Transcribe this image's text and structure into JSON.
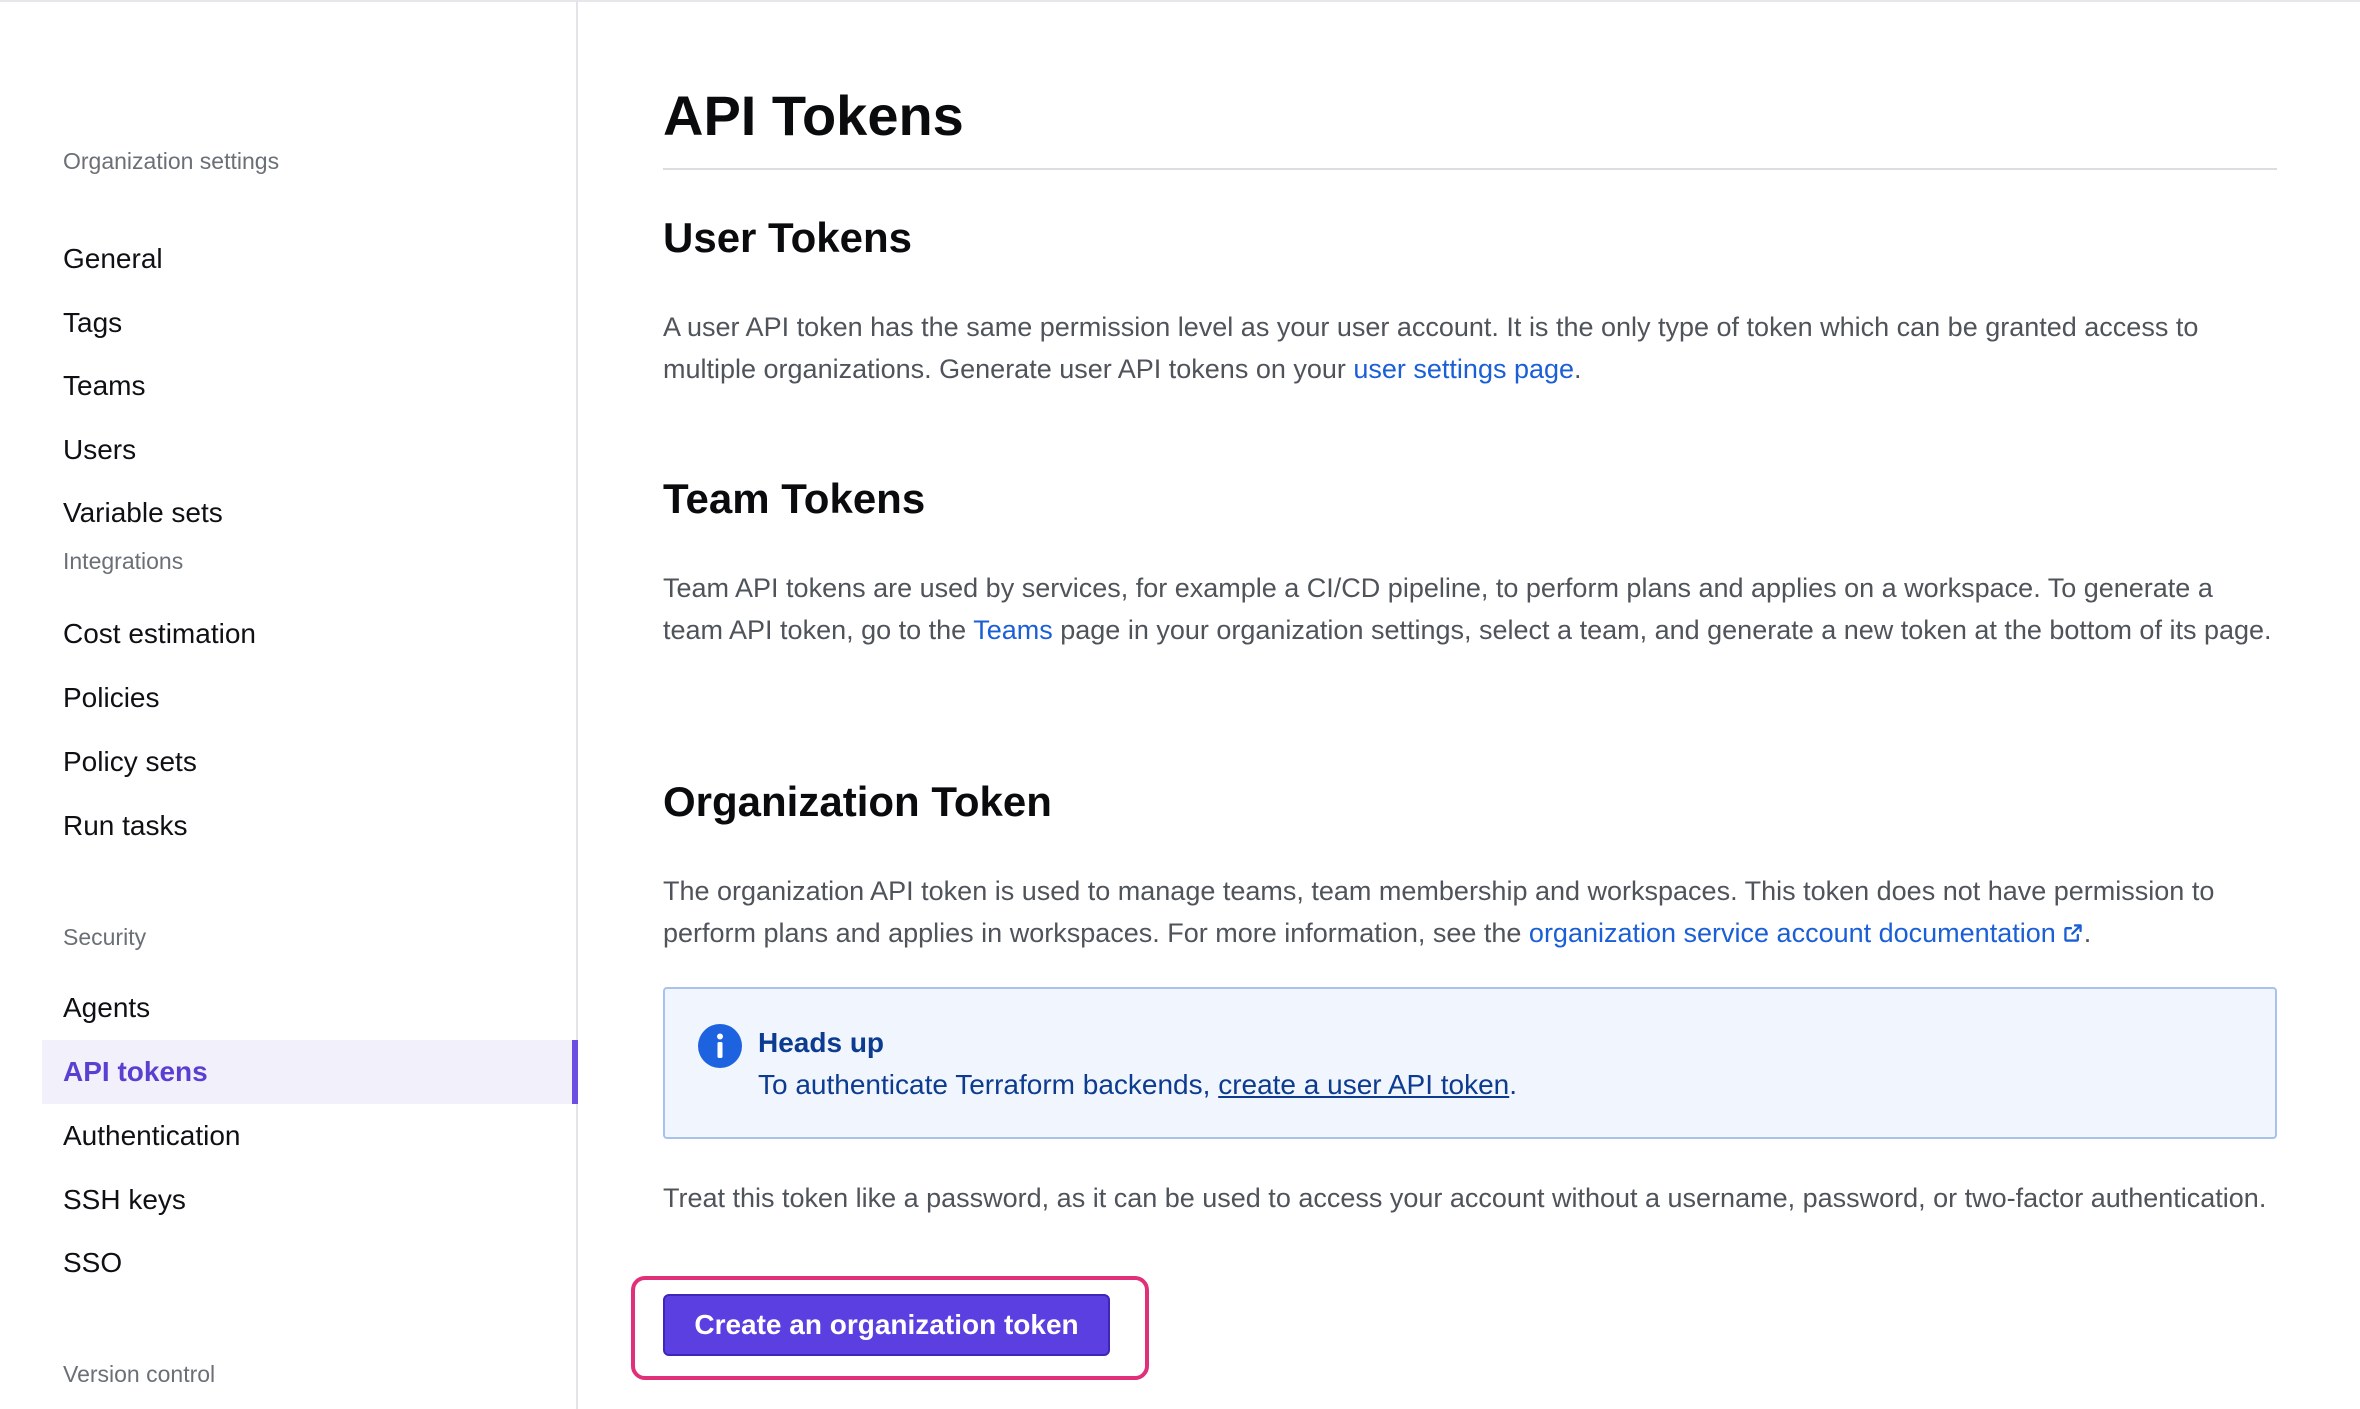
{
  "sidebar": {
    "sections": [
      {
        "heading": "Organization settings",
        "items": [
          "General",
          "Tags",
          "Teams",
          "Users",
          "Variable sets"
        ]
      },
      {
        "heading": "Integrations",
        "items": [
          "Cost estimation",
          "Policies",
          "Policy sets",
          "Run tasks"
        ]
      },
      {
        "heading": "Security",
        "items": [
          "Agents",
          "API tokens",
          "Authentication",
          "SSH keys",
          "SSO"
        ]
      },
      {
        "heading": "Version control",
        "items": []
      }
    ],
    "active_item": "API tokens"
  },
  "main": {
    "title": "API Tokens",
    "user_tokens": {
      "heading": "User Tokens",
      "text_before_link": "A user API token has the same permission level as your user account. It is the only type of token which can be granted access to multiple organizations. Generate user API tokens on your ",
      "link": "user settings page",
      "text_after_link": "."
    },
    "team_tokens": {
      "heading": "Team Tokens",
      "text_before_link": "Team API tokens are used by services, for example a CI/CD pipeline, to perform plans and applies on a workspace. To generate a team API token, go to the ",
      "link": "Teams",
      "text_after_link": " page in your organization settings, select a team, and generate a new token at the bottom of its page."
    },
    "organization_token": {
      "heading": "Organization Token",
      "text_before_link": "The organization API token is used to manage teams, team membership and workspaces. This token does not have permission to perform plans and applies in workspaces. For more information, see the ",
      "link": "organization service account documentation",
      "link_icon": "external-link-icon",
      "text_after_link": ".",
      "callout": {
        "icon": "info-icon",
        "title": "Heads up",
        "text_before_link": "To authenticate Terraform backends, ",
        "link": "create a user API token",
        "text_after_link": "."
      },
      "warning_text": "Treat this token like a password, as it can be used to access your account without a username, password, or two-factor authentication.",
      "create_button_label": "Create an organization token"
    }
  },
  "colors": {
    "accent": "#5b3fe0",
    "active_nav_bg": "#f2f1fb",
    "active_nav_text": "#5b3fd1",
    "link": "#1a5fd6",
    "callout_bg": "#f1f6fe",
    "callout_text": "#0c3b8f",
    "highlight_outline": "#e0307a"
  }
}
